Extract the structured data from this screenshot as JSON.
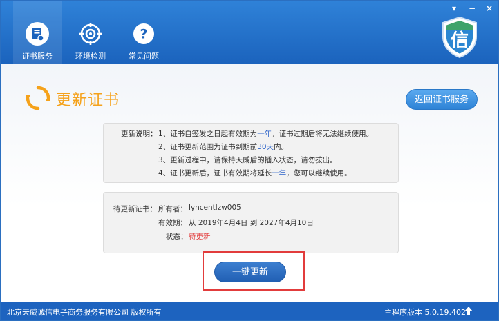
{
  "window_controls": {
    "menu": "▾",
    "minimize": "−",
    "close": "×"
  },
  "nav": [
    {
      "label": "证书服务",
      "icon": "certificate-service-icon",
      "active": true
    },
    {
      "label": "环境检测",
      "icon": "environment-check-icon",
      "active": false
    },
    {
      "label": "常见问题",
      "icon": "help-question-icon",
      "active": false
    }
  ],
  "logo": {
    "text": "信",
    "icon": "shield-xin-logo-icon"
  },
  "page": {
    "title": "更新证书",
    "back_button": "返回证书服务"
  },
  "description": {
    "label": "更新说明：",
    "items": [
      {
        "prefix": "1、证书自签发之日起有效期为",
        "highlight": "一年",
        "suffix": "，证书过期后将无法继续使用。"
      },
      {
        "prefix": "2、证书更新范围为证书到期前",
        "highlight": "30天",
        "suffix": "内。"
      },
      {
        "prefix": "3、更新过程中，请保持天威盾的插入状态，请勿拔出。",
        "highlight": "",
        "suffix": ""
      },
      {
        "prefix": "4、证书更新后，证书有效期将延长",
        "highlight": "一年",
        "suffix": "，您可以继续使用。"
      }
    ]
  },
  "certificate": {
    "section_label": "待更新证书：",
    "owner_label": "所有者：",
    "owner_value": "lyncentlzw005",
    "validity_label": "有效期：",
    "validity_value": "从 2019年4月4日 到 2027年4月10日",
    "status_label": "状态：",
    "status_value": "待更新"
  },
  "action_button": "一键更新",
  "footer": {
    "copyright": "北京天威诚信电子商务服务有限公司 版权所有",
    "version": "主程序版本 5.0.19.402"
  },
  "colors": {
    "header_blue": "#1b63bd",
    "accent_orange": "#f5a21b",
    "highlight_blue": "#2c63c9",
    "status_red": "#e33b3b",
    "annotation_red": "#e23c3c"
  }
}
